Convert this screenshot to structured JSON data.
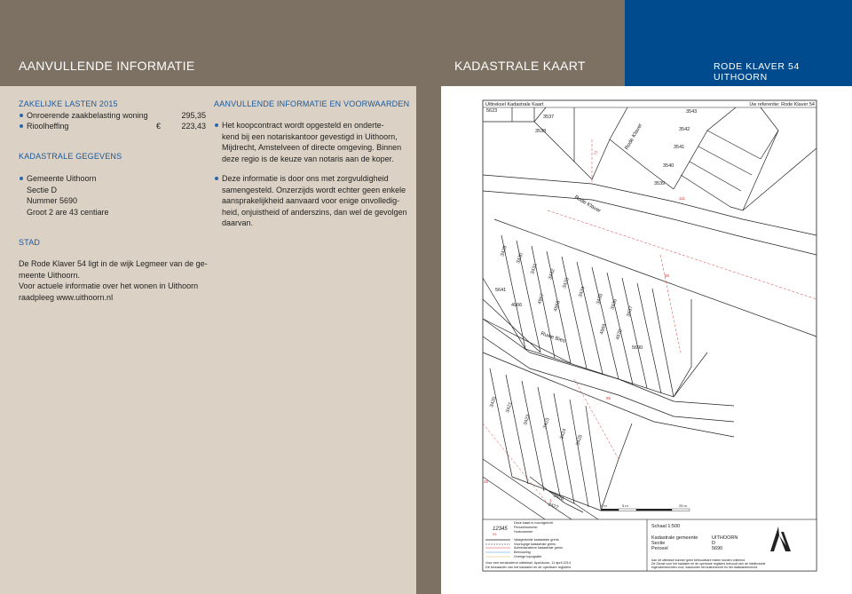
{
  "header": {
    "left_title": "AANVULLENDE INFORMATIE",
    "middle_title": "KADASTRALE KAART",
    "right_title": "RODE KLAVER 54  UITHOORN"
  },
  "lasten": {
    "title": "ZAKELIJKE LASTEN 2015",
    "items": [
      {
        "label": "Onroerende zaakbelasting woning",
        "currency": "",
        "amount": "295,35"
      },
      {
        "label": "Rioolheffing",
        "currency": "€",
        "amount": "223,43"
      }
    ]
  },
  "kadastraal": {
    "title": "KADASTRALE GEGEVENS",
    "first": "Gemeente Uithoorn",
    "lines": [
      "Sectie D",
      "Nummer  5690",
      "Groot 2 are 43 centiare"
    ]
  },
  "stad": {
    "title": "STAD",
    "lines": [
      "De Rode Klaver 54 ligt in de wijk Legmeer van de ge-",
      "meente Uithoorn.",
      "Voor actuele informatie over het wonen in Uithoorn",
      "raadpleeg  www.uithoorn.nl"
    ]
  },
  "voorwaarden": {
    "title": "AANVULLENDE INFORMATIE EN VOORWAARDEN",
    "p1": [
      "Het koopcontract wordt opgesteld en onderte-",
      "kend bij een notariskantoor gevestigd in Uithoorn,",
      "Mijdrecht, Amstelveen of directe omgeving. Binnen",
      "deze regio is de keuze van notaris aan de koper."
    ],
    "p2": [
      "Deze informatie is door ons met zorgvuldigheid",
      "samengesteld. Onzerzijds wordt echter geen enkele",
      "aansprakelijkheid aanvaard voor enige onvolledig-",
      "heid, onjuistheid of anderszins, dan wel de gevolgen",
      "daarvan."
    ]
  },
  "map": {
    "header_left": "Uittreksel Kadastrale Kaart",
    "header_right": "Uw referentie: Rode Klaver 54",
    "parcels_top": [
      "5623",
      "3537",
      "3538",
      "3543",
      "3542",
      "3541",
      "3540",
      "3539"
    ],
    "parcels_mid": [
      "3429",
      "3430",
      "3431",
      "3432",
      "3433",
      "3434",
      "4967",
      "4968",
      "3435",
      "3436",
      "3437",
      "4969",
      "4970",
      "5641",
      "4966",
      "5690"
    ],
    "parcels_low": [
      "3420",
      "3421",
      "3422",
      "3423",
      "3424",
      "3425"
    ],
    "parcels_bottom": [
      "3426",
      "3427"
    ],
    "house_numbers": [
      "71",
      "111",
      "85",
      "95",
      "25",
      "1"
    ],
    "streets": [
      "Rode Klaver",
      "Rode Klaver",
      "Ruwe Bies"
    ],
    "scale_ticks": [
      "0 m",
      "5 m",
      "25 m"
    ],
    "legend_sample_number": "12345",
    "legend_sample_house": "25",
    "legend": [
      "Deze kaart is noordgericht",
      "Perceelnummer",
      "Huisnummer",
      "Vastgestelde kadastrale grens",
      "Voorlopige kadastrale grens",
      "Administratieve kadastrale grens",
      "Bebouwing",
      "Overige topografie",
      "Voor een eensluidend uittreksel, Apeldoorn, 11 april 2014",
      "De bewaarder van het kadaster en de openbare registers"
    ],
    "scale_label": "Schaal 1:500",
    "info_labels": [
      "Kadastrale gemeente",
      "Sectie",
      "Perceel"
    ],
    "info_values": [
      "UITHOORN",
      "D",
      "5690"
    ],
    "disclaimer": [
      "Aan dit uittreksel kunnen geen betrouwbare maten worden ontleend.",
      "De Dienst voor het kadaster en de openbare registers behoudt zich de intellectuele",
      "eigendomsrechten voor, waaronder het auteursrecht en het databankenrecht."
    ]
  },
  "colors": {
    "taupe": "#7d7164",
    "blue": "#004b8d",
    "beige": "#dbd1c4",
    "accent_text": "#1a5aa0",
    "house_number": "#d23c3c"
  }
}
